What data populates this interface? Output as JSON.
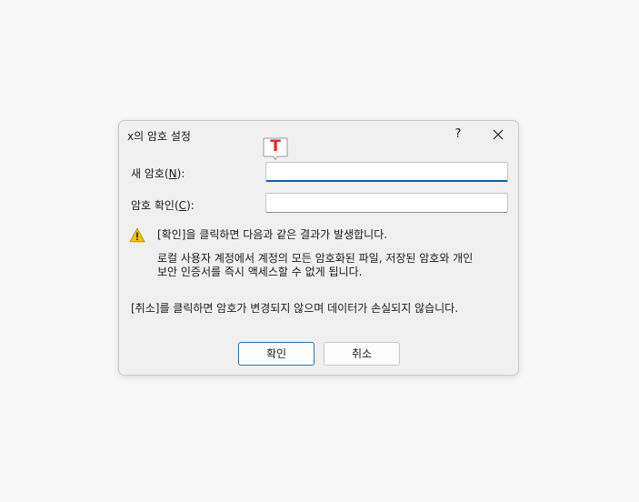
{
  "dialog": {
    "title": "x의 암호 설정",
    "help_label": "?",
    "new_password": {
      "label_prefix": "새 암호(",
      "accesskey": "N",
      "label_suffix": "):",
      "value": ""
    },
    "confirm_password": {
      "label_prefix": "암호 확인(",
      "accesskey": "C",
      "label_suffix": "):",
      "value": ""
    },
    "ime_indicator": "T",
    "warning": {
      "headline": "[확인]을 클릭하면 다음과 같은 결과가 발생합니다.",
      "line1": "로컬 사용자 계정에서 계정의 모든 암호화된 파일, 저장된 암호와 개인",
      "line2": "보안 인증서를 즉시 액세스할 수 없게 됩니다."
    },
    "cancel_note": "[취소]를 클릭하면 암호가 변경되지 않으며 데이터가 손실되지 않습니다.",
    "ok_label": "확인",
    "cancel_label": "취소"
  },
  "colors": {
    "focus_underline": "#0a5fb4",
    "ime_badge_red": "#e0261f",
    "warning_yellow": "#f2c40f"
  }
}
